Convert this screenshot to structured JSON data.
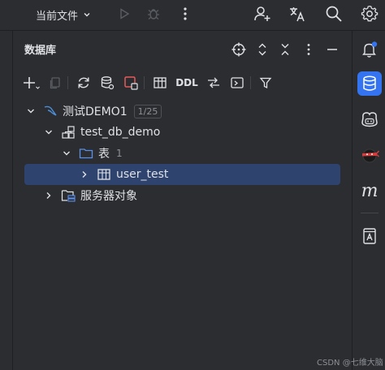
{
  "toolbar_top": {
    "run_config_label": "当前文件"
  },
  "panel": {
    "title": "数据库"
  },
  "db_toolbar": {
    "ddl_label": "DDL"
  },
  "tree": {
    "datasource": {
      "label": "测试DEMO1",
      "badge": "1/25"
    },
    "schema": {
      "label": "test_db_demo"
    },
    "tables_folder": {
      "label": "表",
      "count": "1"
    },
    "table": {
      "label": "user_test"
    },
    "server_objects": {
      "label": "服务器对象"
    }
  },
  "rightbar": {
    "m_glyph": "m"
  },
  "watermark": "CSDN @七维大脑",
  "colors": {
    "background": "#2b2d30",
    "selection": "#2e436e",
    "active_tool": "#3574f0",
    "notification_dot": "#3574f0",
    "record_red": "#e55b5b"
  }
}
